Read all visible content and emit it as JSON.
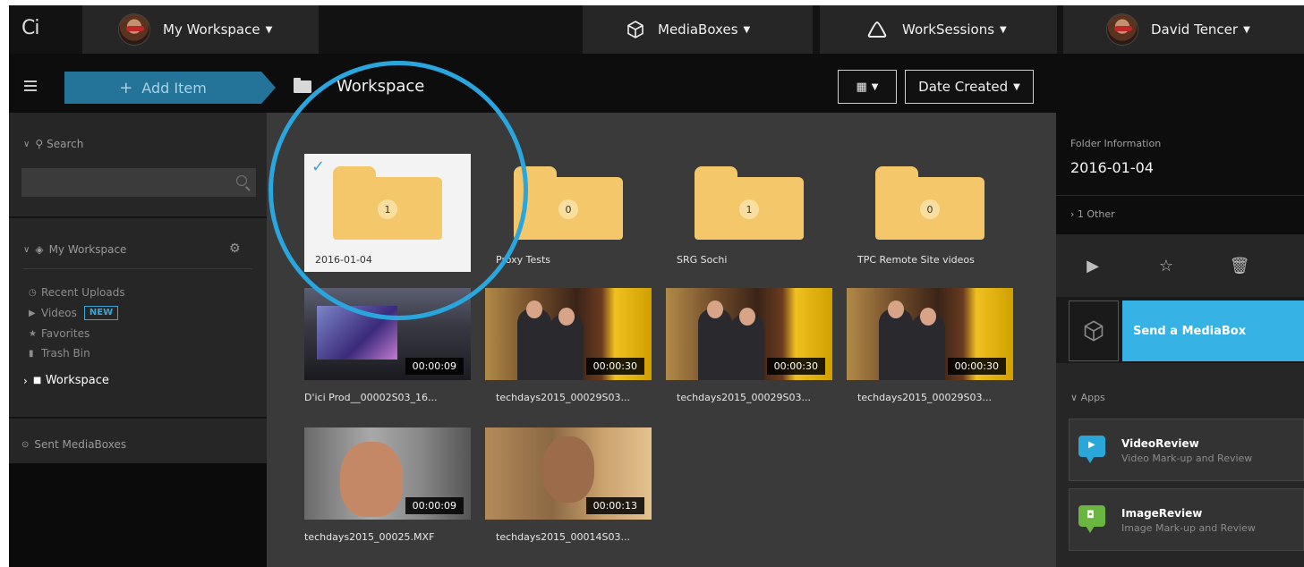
{
  "topbar": {
    "logo": "Ci",
    "workspace_label": "My Workspace",
    "mediaboxes_label": "MediaBoxes",
    "worksessions_label": "WorkSessions",
    "user_name": "David Tencer"
  },
  "toolbar": {
    "add_item_label": "Add Item",
    "breadcrumb_title": "Workspace",
    "view_icon": "grid-icon",
    "sort_label": "Date Created"
  },
  "sidebar": {
    "search_label": "Search",
    "search_placeholder": "",
    "section_title": "My Workspace",
    "items": [
      {
        "label": "Recent Uploads",
        "icon": "clock-icon"
      },
      {
        "label": "Videos",
        "icon": "play-icon",
        "badge": "NEW"
      },
      {
        "label": "Favorites",
        "icon": "star-icon"
      },
      {
        "label": "Trash Bin",
        "icon": "trash-icon"
      },
      {
        "label": "Workspace",
        "icon": "folder-icon"
      }
    ],
    "sent_label": "Sent MediaBoxes"
  },
  "folders": [
    {
      "name": "2016-01-04",
      "count": "1",
      "selected": true
    },
    {
      "name": "Proxy Tests",
      "count": "0"
    },
    {
      "name": "SRG Sochi",
      "count": "1"
    },
    {
      "name": "TPC Remote Site videos",
      "count": "0"
    }
  ],
  "videos": [
    {
      "name": "D'ici Prod__00002S03_16...",
      "duration": "00:00:09"
    },
    {
      "name": "techdays2015_00029S03...",
      "duration": "00:00:30"
    },
    {
      "name": "techdays2015_00029S03...",
      "duration": "00:00:30"
    },
    {
      "name": "techdays2015_00029S03...",
      "duration": "00:00:30"
    },
    {
      "name": "techdays2015_00025.MXF",
      "duration": "00:00:09"
    },
    {
      "name": "techdays2015_00014S03...",
      "duration": "00:00:13"
    }
  ],
  "right_panel": {
    "folder_info_label": "Folder Information",
    "folder_name": "2016-01-04",
    "other_label": "1 Other",
    "send_label": "Send a MediaBox",
    "apps_label": "Apps",
    "apps": [
      {
        "name": "VideoReview",
        "desc": "Video Mark-up and Review",
        "color": "#2aa7d8"
      },
      {
        "name": "ImageReview",
        "desc": "Image Mark-up and Review",
        "color": "#6ab640"
      }
    ]
  }
}
